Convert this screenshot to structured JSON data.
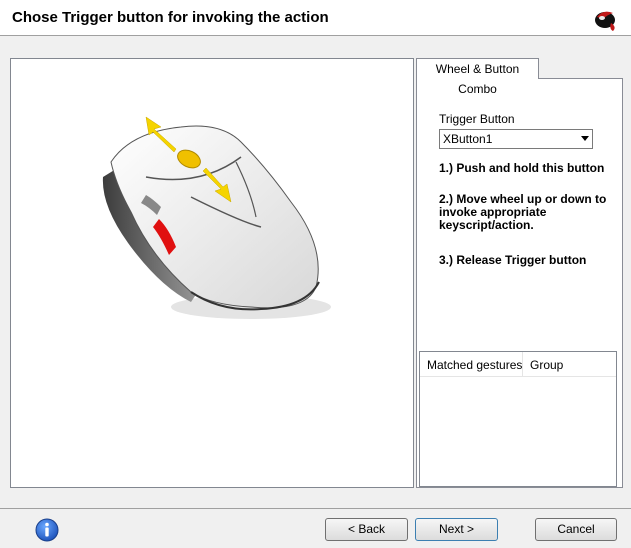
{
  "header": {
    "title": "Chose Trigger button for invoking the action",
    "logo_icon": "mouse-logo-icon"
  },
  "tabs": [
    {
      "label": "Wheel & Button Combo",
      "selected": true
    }
  ],
  "trigger": {
    "label": "Trigger Button",
    "selected_value": "XButton1"
  },
  "steps": {
    "step1": "1.) Push and hold this button",
    "step2": "2.) Move wheel up or down to invoke appropriate keyscript/action.",
    "step3": "3.) Release Trigger button"
  },
  "gestures_list": {
    "columns": [
      "Matched gestures",
      "Group"
    ],
    "rows": []
  },
  "footer": {
    "info_icon": "info-icon",
    "back_label": "< Back",
    "next_label": "Next >",
    "cancel_label": "Cancel"
  },
  "colors": {
    "highlight_trigger_button": "#e01010",
    "arrow": "#f5d400",
    "wheel": "#f0c000"
  }
}
